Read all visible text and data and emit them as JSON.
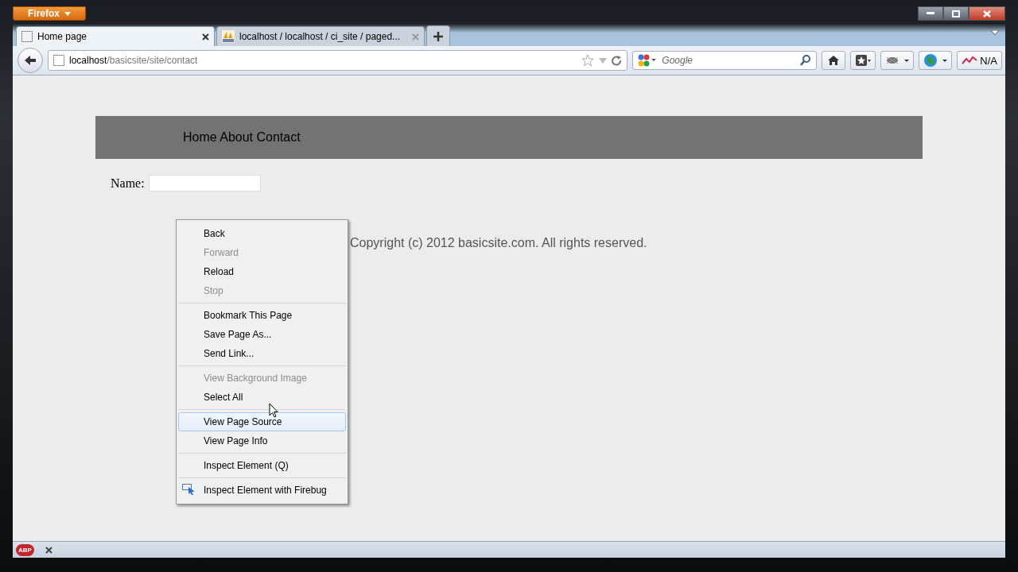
{
  "app_button": {
    "label": "Firefox"
  },
  "tabs": [
    {
      "title": "Home page",
      "selected": true,
      "kind": "blank"
    },
    {
      "title": "localhost / localhost / ci_site / paged...",
      "selected": false,
      "kind": "pma"
    }
  ],
  "address_bar": {
    "host": "localhost",
    "path": "/basicsite/site/contact"
  },
  "search_field": {
    "placeholder": "Google"
  },
  "toolbar_buttons": [
    {
      "kind": "home"
    },
    {
      "kind": "bookmarks"
    },
    {
      "kind": "firebug"
    },
    {
      "kind": "globe"
    },
    {
      "kind": "stats",
      "label": "N/A"
    }
  ],
  "page": {
    "nav": "Home About Contact",
    "name_label": "Name:",
    "footer": "Copyright (c) 2012 basicsite.com. All rights reserved."
  },
  "context_menu": [
    {
      "items": [
        {
          "label": "Back",
          "disabled": false,
          "selected": false
        },
        {
          "label": "Forward",
          "disabled": true,
          "selected": false
        },
        {
          "label": "Reload",
          "disabled": false,
          "selected": false
        },
        {
          "label": "Stop",
          "disabled": true,
          "selected": false
        }
      ]
    },
    {
      "items": [
        {
          "label": "Bookmark This Page",
          "disabled": false,
          "selected": false
        },
        {
          "label": "Save Page As...",
          "disabled": false,
          "selected": false
        },
        {
          "label": "Send Link...",
          "disabled": false,
          "selected": false
        }
      ]
    },
    {
      "items": [
        {
          "label": "View Background Image",
          "disabled": true,
          "selected": false
        },
        {
          "label": "Select All",
          "disabled": false,
          "selected": false
        }
      ]
    },
    {
      "items": [
        {
          "label": "View Page Source",
          "disabled": false,
          "selected": true
        },
        {
          "label": "View Page Info",
          "disabled": false,
          "selected": false
        }
      ]
    },
    {
      "items": [
        {
          "label": "Inspect Element (Q)",
          "disabled": false,
          "selected": false
        }
      ]
    },
    {
      "items": [
        {
          "label": "Inspect Element with Firebug",
          "disabled": false,
          "selected": false,
          "kind": "firebug"
        }
      ]
    }
  ],
  "addon_bar": {
    "adblock_label": "ABP"
  }
}
